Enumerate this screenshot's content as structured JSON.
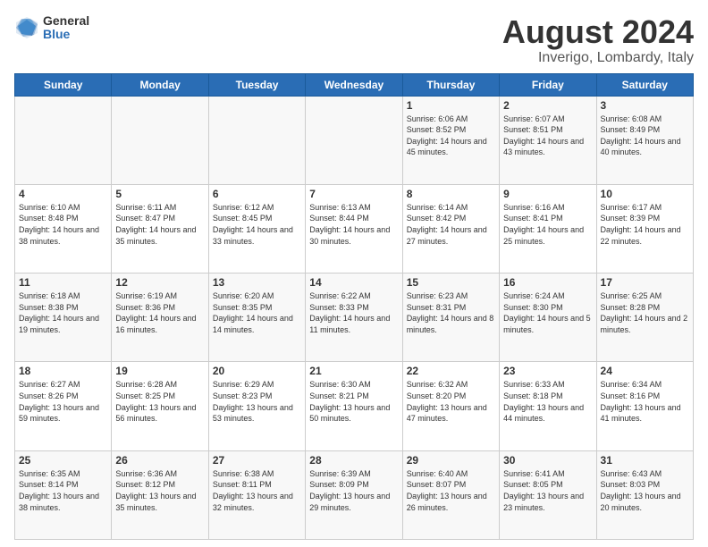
{
  "logo": {
    "general": "General",
    "blue": "Blue"
  },
  "title": {
    "month_year": "August 2024",
    "location": "Inverigo, Lombardy, Italy"
  },
  "weekdays": [
    "Sunday",
    "Monday",
    "Tuesday",
    "Wednesday",
    "Thursday",
    "Friday",
    "Saturday"
  ],
  "weeks": [
    [
      {
        "day": "",
        "info": ""
      },
      {
        "day": "",
        "info": ""
      },
      {
        "day": "",
        "info": ""
      },
      {
        "day": "",
        "info": ""
      },
      {
        "day": "1",
        "info": "Sunrise: 6:06 AM\nSunset: 8:52 PM\nDaylight: 14 hours and 45 minutes."
      },
      {
        "day": "2",
        "info": "Sunrise: 6:07 AM\nSunset: 8:51 PM\nDaylight: 14 hours and 43 minutes."
      },
      {
        "day": "3",
        "info": "Sunrise: 6:08 AM\nSunset: 8:49 PM\nDaylight: 14 hours and 40 minutes."
      }
    ],
    [
      {
        "day": "4",
        "info": "Sunrise: 6:10 AM\nSunset: 8:48 PM\nDaylight: 14 hours and 38 minutes."
      },
      {
        "day": "5",
        "info": "Sunrise: 6:11 AM\nSunset: 8:47 PM\nDaylight: 14 hours and 35 minutes."
      },
      {
        "day": "6",
        "info": "Sunrise: 6:12 AM\nSunset: 8:45 PM\nDaylight: 14 hours and 33 minutes."
      },
      {
        "day": "7",
        "info": "Sunrise: 6:13 AM\nSunset: 8:44 PM\nDaylight: 14 hours and 30 minutes."
      },
      {
        "day": "8",
        "info": "Sunrise: 6:14 AM\nSunset: 8:42 PM\nDaylight: 14 hours and 27 minutes."
      },
      {
        "day": "9",
        "info": "Sunrise: 6:16 AM\nSunset: 8:41 PM\nDaylight: 14 hours and 25 minutes."
      },
      {
        "day": "10",
        "info": "Sunrise: 6:17 AM\nSunset: 8:39 PM\nDaylight: 14 hours and 22 minutes."
      }
    ],
    [
      {
        "day": "11",
        "info": "Sunrise: 6:18 AM\nSunset: 8:38 PM\nDaylight: 14 hours and 19 minutes."
      },
      {
        "day": "12",
        "info": "Sunrise: 6:19 AM\nSunset: 8:36 PM\nDaylight: 14 hours and 16 minutes."
      },
      {
        "day": "13",
        "info": "Sunrise: 6:20 AM\nSunset: 8:35 PM\nDaylight: 14 hours and 14 minutes."
      },
      {
        "day": "14",
        "info": "Sunrise: 6:22 AM\nSunset: 8:33 PM\nDaylight: 14 hours and 11 minutes."
      },
      {
        "day": "15",
        "info": "Sunrise: 6:23 AM\nSunset: 8:31 PM\nDaylight: 14 hours and 8 minutes."
      },
      {
        "day": "16",
        "info": "Sunrise: 6:24 AM\nSunset: 8:30 PM\nDaylight: 14 hours and 5 minutes."
      },
      {
        "day": "17",
        "info": "Sunrise: 6:25 AM\nSunset: 8:28 PM\nDaylight: 14 hours and 2 minutes."
      }
    ],
    [
      {
        "day": "18",
        "info": "Sunrise: 6:27 AM\nSunset: 8:26 PM\nDaylight: 13 hours and 59 minutes."
      },
      {
        "day": "19",
        "info": "Sunrise: 6:28 AM\nSunset: 8:25 PM\nDaylight: 13 hours and 56 minutes."
      },
      {
        "day": "20",
        "info": "Sunrise: 6:29 AM\nSunset: 8:23 PM\nDaylight: 13 hours and 53 minutes."
      },
      {
        "day": "21",
        "info": "Sunrise: 6:30 AM\nSunset: 8:21 PM\nDaylight: 13 hours and 50 minutes."
      },
      {
        "day": "22",
        "info": "Sunrise: 6:32 AM\nSunset: 8:20 PM\nDaylight: 13 hours and 47 minutes."
      },
      {
        "day": "23",
        "info": "Sunrise: 6:33 AM\nSunset: 8:18 PM\nDaylight: 13 hours and 44 minutes."
      },
      {
        "day": "24",
        "info": "Sunrise: 6:34 AM\nSunset: 8:16 PM\nDaylight: 13 hours and 41 minutes."
      }
    ],
    [
      {
        "day": "25",
        "info": "Sunrise: 6:35 AM\nSunset: 8:14 PM\nDaylight: 13 hours and 38 minutes."
      },
      {
        "day": "26",
        "info": "Sunrise: 6:36 AM\nSunset: 8:12 PM\nDaylight: 13 hours and 35 minutes."
      },
      {
        "day": "27",
        "info": "Sunrise: 6:38 AM\nSunset: 8:11 PM\nDaylight: 13 hours and 32 minutes."
      },
      {
        "day": "28",
        "info": "Sunrise: 6:39 AM\nSunset: 8:09 PM\nDaylight: 13 hours and 29 minutes."
      },
      {
        "day": "29",
        "info": "Sunrise: 6:40 AM\nSunset: 8:07 PM\nDaylight: 13 hours and 26 minutes."
      },
      {
        "day": "30",
        "info": "Sunrise: 6:41 AM\nSunset: 8:05 PM\nDaylight: 13 hours and 23 minutes."
      },
      {
        "day": "31",
        "info": "Sunrise: 6:43 AM\nSunset: 8:03 PM\nDaylight: 13 hours and 20 minutes."
      }
    ]
  ]
}
